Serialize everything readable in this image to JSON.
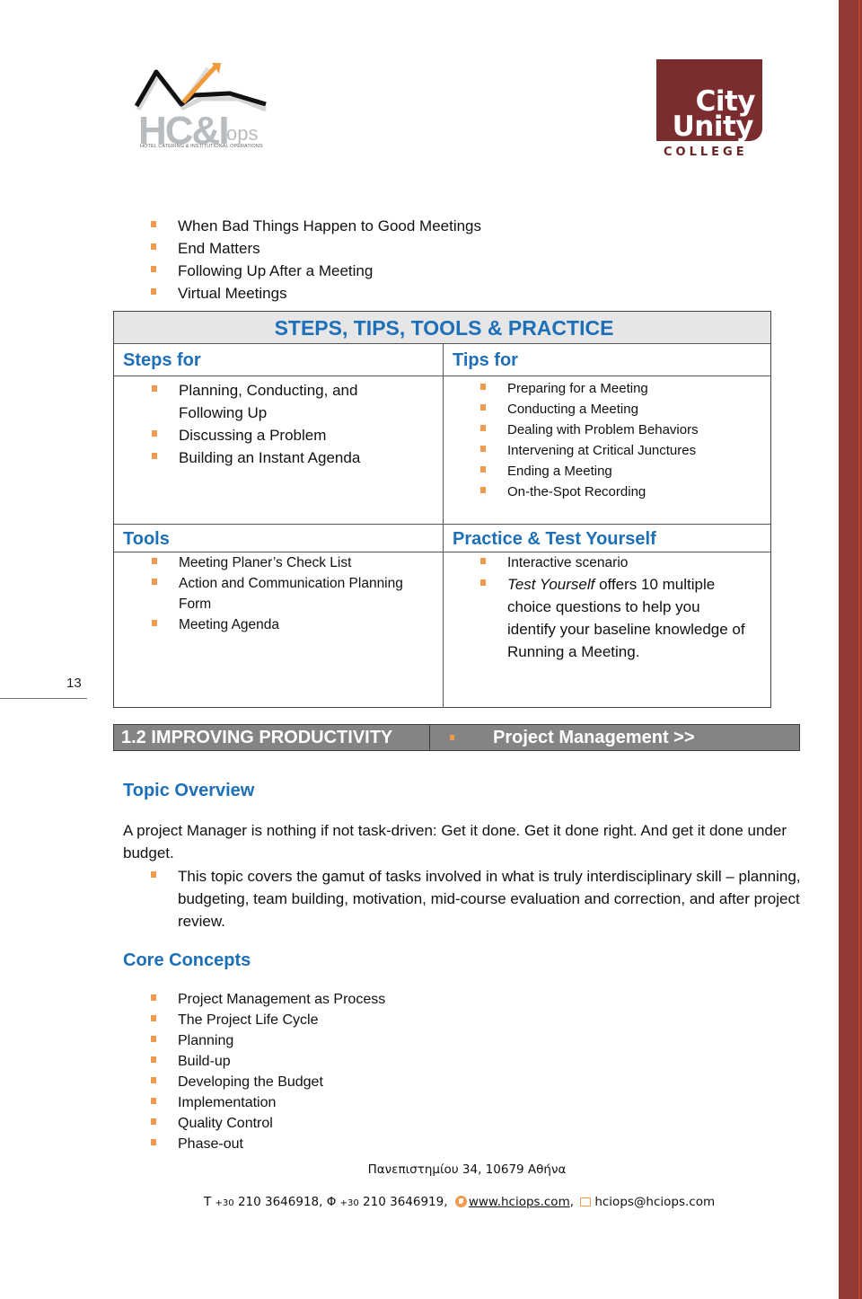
{
  "logos": {
    "left": {
      "word": "HC&I",
      "suffix": "ops",
      "subtitle": "HOTEL CATERING & INSTITUTIONAL OPERATIONS"
    },
    "right": {
      "line1": "City",
      "line2": "Unity",
      "line3": "COLLEGE"
    }
  },
  "intro_list": [
    "When Bad Things Happen to Good Meetings",
    "End Matters",
    "Following Up After a Meeting",
    "Virtual Meetings"
  ],
  "table": {
    "title": "STEPS, TIPS, TOOLS & PRACTICE",
    "steps": {
      "heading": "Steps for",
      "items": [
        "Planning, Conducting, and Following Up",
        "Discussing a Problem",
        "Building an Instant Agenda"
      ]
    },
    "tips": {
      "heading": "Tips for",
      "items": [
        "Preparing for a Meeting",
        "Conducting a Meeting",
        "Dealing with Problem Behaviors",
        "Intervening at Critical Junctures",
        "Ending a Meeting",
        "On-the-Spot Recording"
      ]
    },
    "tools": {
      "heading": "Tools",
      "items": [
        "Meeting Planer’s Check List",
        "Action and Communication Planning Form",
        "Meeting Agenda"
      ]
    },
    "practice": {
      "heading": "Practice & Test Yourself",
      "item1": "Interactive scenario",
      "item2_em": "Test Yourself",
      "item2_rest": " offers 10 multiple choice questions to help you identify your baseline knowledge of Running a Meeting."
    }
  },
  "page_number": "13",
  "section_bar": {
    "left": "1.2 IMPROVING PRODUCTIVITY",
    "right": "Project Management >>"
  },
  "topic_overview": {
    "heading": "Topic Overview",
    "paragraph": "A project Manager is nothing if not task-driven: Get it done. Get it done right. And get it done under budget.",
    "items": [
      "This topic covers the gamut of tasks involved in what is truly interdisciplinary skill – planning, budgeting, team building, motivation, mid-course evaluation and correction, and after project review."
    ]
  },
  "core_concepts": {
    "heading": "Core Concepts",
    "items": [
      "Project Management as Process",
      "The Project Life Cycle",
      "Planning",
      "Build-up",
      "Developing the Budget",
      "Implementation",
      "Quality Control",
      "Phase-out"
    ]
  },
  "footer": {
    "address": "Πανεπιστημίου 34, 10679 Αθήνα",
    "phone_prefix": "T",
    "phone_cc": "+30",
    "phone": " 210 3646918, ",
    "fax_prefix": "Φ",
    "fax_cc": "+30",
    "fax": " 210 3646919,",
    "website": "www.hciops.com",
    "email": "hciops@hciops.com"
  }
}
